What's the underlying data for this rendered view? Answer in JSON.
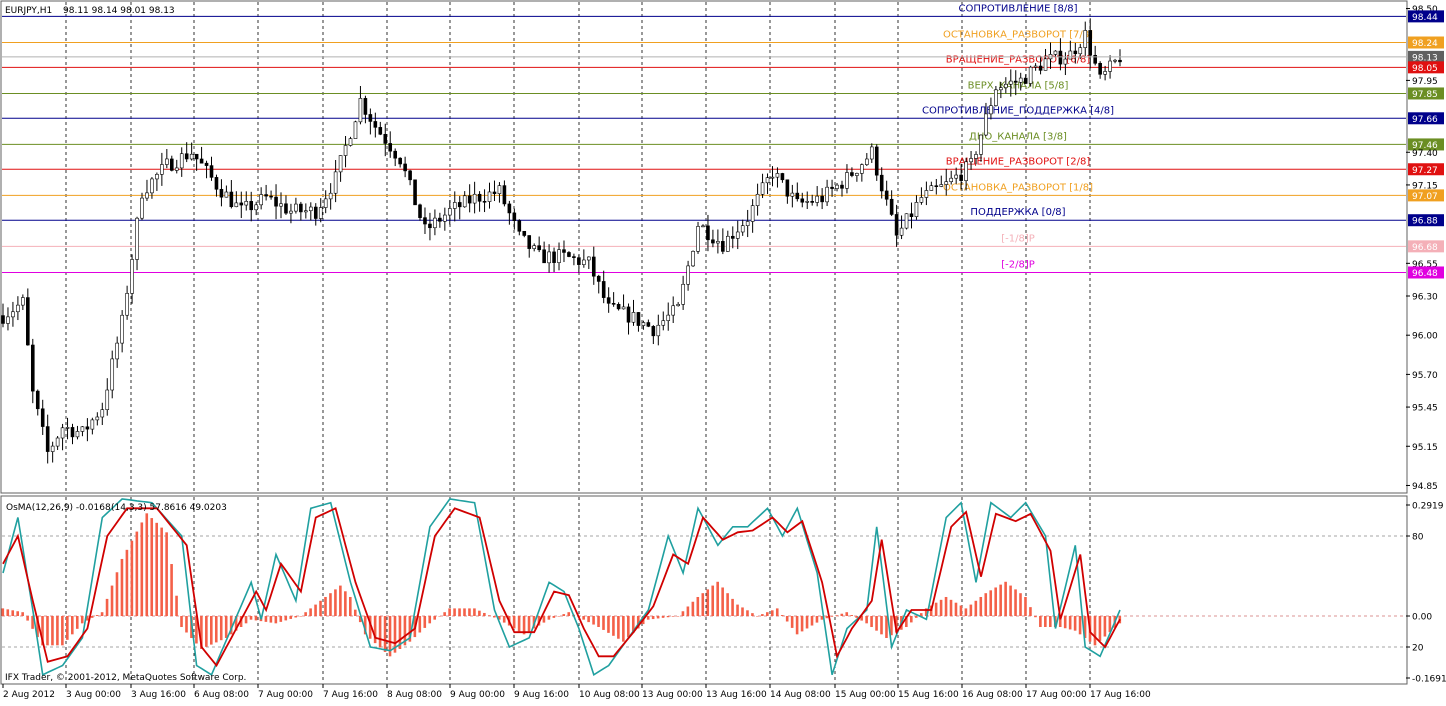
{
  "header": {
    "symbol": "EURJPY,H1",
    "ohlc": "98.11 98.14 98.01 98.13"
  },
  "indicator": {
    "header": "OsMA(12,26,9) -0.0168",
    "header2": "(14,3,3) 57.8616 49.0203"
  },
  "copyright": "IFX Trader, © 2001-2012, MetaQuotes Software Corp.",
  "colors": {
    "blue": "#00008b",
    "orange": "#f0a020",
    "red": "#e01010",
    "olive": "#6b8e23",
    "pink": "#f4b0b8",
    "magenta": "#e000e0",
    "hist": "#f46048",
    "osc_fast": "#20a0a0",
    "osc_slow": "#d00000",
    "candle": "#000000"
  },
  "chart_data": [
    {
      "type": "candlestick",
      "title": "EURJPY,H1",
      "ylim": [
        94.8,
        98.55
      ],
      "y_ticks": [
        "98.50",
        "98.44",
        "98.24",
        "98.13",
        "98.05",
        "97.95",
        "97.85",
        "97.66",
        "97.46",
        "97.40",
        "97.27",
        "97.15",
        "97.07",
        "96.88",
        "96.68",
        "96.55",
        "96.48",
        "96.30",
        "96.00",
        "95.70",
        "95.45",
        "95.15",
        "94.85"
      ],
      "x_ticks": [
        "2 Aug 2012",
        "3 Aug 00:00",
        "3 Aug 16:00",
        "6 Aug 08:00",
        "7 Aug 00:00",
        "7 Aug 16:00",
        "8 Aug 08:00",
        "9 Aug 00:00",
        "9 Aug 16:00",
        "10 Aug 08:00",
        "13 Aug 00:00",
        "13 Aug 16:00",
        "14 Aug 08:00",
        "15 Aug 00:00",
        "15 Aug 16:00",
        "16 Aug 08:00",
        "17 Aug 00:00",
        "17 Aug 16:00"
      ],
      "last_price": 98.13,
      "path_points": [
        [
          0,
          96.15
        ],
        [
          4,
          96.25
        ],
        [
          6,
          95.55
        ],
        [
          9,
          95.1
        ],
        [
          12,
          95.3
        ],
        [
          16,
          95.25
        ],
        [
          20,
          95.45
        ],
        [
          24,
          96.1
        ],
        [
          28,
          97.1
        ],
        [
          33,
          97.3
        ],
        [
          38,
          97.4
        ],
        [
          43,
          97.15
        ],
        [
          48,
          96.95
        ],
        [
          53,
          97.05
        ],
        [
          58,
          96.95
        ],
        [
          63,
          96.95
        ],
        [
          67,
          97.2
        ],
        [
          72,
          97.8
        ],
        [
          75,
          97.6
        ],
        [
          80,
          97.35
        ],
        [
          85,
          96.8
        ],
        [
          90,
          96.95
        ],
        [
          95,
          97.05
        ],
        [
          100,
          97.1
        ],
        [
          104,
          96.75
        ],
        [
          108,
          96.6
        ],
        [
          113,
          96.6
        ],
        [
          118,
          96.55
        ],
        [
          122,
          96.2
        ],
        [
          126,
          96.15
        ],
        [
          131,
          96.05
        ],
        [
          136,
          96.2
        ],
        [
          140,
          96.85
        ],
        [
          145,
          96.7
        ],
        [
          150,
          96.9
        ],
        [
          155,
          97.25
        ],
        [
          160,
          97.0
        ],
        [
          165,
          97.05
        ],
        [
          170,
          97.2
        ],
        [
          175,
          97.4
        ],
        [
          180,
          96.75
        ],
        [
          185,
          97.05
        ],
        [
          190,
          97.15
        ],
        [
          195,
          97.3
        ],
        [
          200,
          97.9
        ],
        [
          205,
          97.95
        ],
        [
          210,
          98.1
        ],
        [
          215,
          98.15
        ],
        [
          218,
          98.3
        ],
        [
          221,
          97.95
        ],
        [
          225,
          98.13
        ]
      ],
      "levels": [
        {
          "label": "СОПРОТИВЛЕНИЕ [8/8]",
          "value": "98.44",
          "color": "blue"
        },
        {
          "label": "ОСТАНОВКА_РАЗВОРОТ [7/8]",
          "value": "98.24",
          "color": "orange"
        },
        {
          "label": "ВРАЩЕНИЕ_РАЗВОРОТ [6/8]",
          "value": "98.05",
          "color": "red"
        },
        {
          "label": "ВЕРХ_КАНАЛА [5/8]",
          "value": "97.85",
          "color": "olive"
        },
        {
          "label": "СОПРОТИВЛЕНИЕ_ПОДДЕРЖКА [4/8]",
          "value": "97.66",
          "color": "blue"
        },
        {
          "label": "ДНО_КАНАЛА [3/8]",
          "value": "97.46",
          "color": "olive"
        },
        {
          "label": "ВРАЩЕНИЕ_РАЗВОРОТ [2/8]",
          "value": "97.27",
          "color": "red"
        },
        {
          "label": "ОСТАНОВКА_РАЗВОРОТ [1/8]",
          "value": "97.07",
          "color": "orange"
        },
        {
          "label": "ПОДДЕРЖКА [0/8]",
          "value": "96.88",
          "color": "blue"
        },
        {
          "label": "[-1/8]P",
          "value": "96.68",
          "color": "pink"
        },
        {
          "label": "[-2/8]P",
          "value": "96.48",
          "color": "magenta"
        }
      ]
    },
    {
      "type": "bar",
      "title": "OsMA(12,26,9) -0.0168",
      "ylim": [
        -0.1691,
        0.2919
      ],
      "y_ticks": [
        "0.2919",
        "80",
        "0.00",
        "20",
        "-0.1691"
      ],
      "histogram_keypoints": [
        [
          0,
          0.02
        ],
        [
          4,
          0.01
        ],
        [
          8,
          -0.08
        ],
        [
          12,
          -0.08
        ],
        [
          16,
          -0.02
        ],
        [
          20,
          0.01
        ],
        [
          24,
          0.15
        ],
        [
          29,
          0.27
        ],
        [
          33,
          0.22
        ],
        [
          36,
          -0.03
        ],
        [
          40,
          -0.09
        ],
        [
          45,
          -0.06
        ],
        [
          50,
          -0.01
        ],
        [
          55,
          -0.02
        ],
        [
          60,
          0.0
        ],
        [
          64,
          0.04
        ],
        [
          68,
          0.08
        ],
        [
          70,
          0.05
        ],
        [
          73,
          -0.05
        ],
        [
          78,
          -0.11
        ],
        [
          82,
          -0.07
        ],
        [
          86,
          -0.02
        ],
        [
          90,
          0.02
        ],
        [
          95,
          0.02
        ],
        [
          100,
          -0.01
        ],
        [
          105,
          -0.05
        ],
        [
          110,
          -0.01
        ],
        [
          114,
          0.01
        ],
        [
          120,
          -0.03
        ],
        [
          125,
          -0.07
        ],
        [
          130,
          -0.01
        ],
        [
          136,
          0.0
        ],
        [
          140,
          0.05
        ],
        [
          144,
          0.09
        ],
        [
          148,
          0.03
        ],
        [
          152,
          0.0
        ],
        [
          156,
          0.02
        ],
        [
          160,
          -0.05
        ],
        [
          165,
          -0.01
        ],
        [
          170,
          0.01
        ],
        [
          174,
          -0.02
        ],
        [
          178,
          -0.06
        ],
        [
          182,
          -0.03
        ],
        [
          186,
          0.02
        ],
        [
          190,
          0.05
        ],
        [
          194,
          0.02
        ],
        [
          198,
          0.06
        ],
        [
          202,
          0.09
        ],
        [
          206,
          0.05
        ],
        [
          209,
          -0.03
        ],
        [
          213,
          -0.03
        ],
        [
          216,
          -0.04
        ],
        [
          220,
          -0.08
        ],
        [
          225,
          -0.02
        ]
      ],
      "stochastic": {
        "fast_keypoints": [
          [
            0,
            60
          ],
          [
            3,
            90
          ],
          [
            6,
            40
          ],
          [
            8,
            5
          ],
          [
            12,
            10
          ],
          [
            16,
            25
          ],
          [
            20,
            90
          ],
          [
            24,
            100
          ],
          [
            30,
            98
          ],
          [
            36,
            80
          ],
          [
            39,
            10
          ],
          [
            42,
            5
          ],
          [
            46,
            30
          ],
          [
            50,
            55
          ],
          [
            52,
            35
          ],
          [
            55,
            70
          ],
          [
            59,
            45
          ],
          [
            62,
            95
          ],
          [
            66,
            98
          ],
          [
            70,
            55
          ],
          [
            74,
            20
          ],
          [
            78,
            18
          ],
          [
            82,
            25
          ],
          [
            86,
            85
          ],
          [
            90,
            100
          ],
          [
            95,
            98
          ],
          [
            99,
            40
          ],
          [
            102,
            20
          ],
          [
            106,
            25
          ],
          [
            110,
            55
          ],
          [
            113,
            50
          ],
          [
            116,
            30
          ],
          [
            119,
            5
          ],
          [
            122,
            10
          ],
          [
            126,
            25
          ],
          [
            130,
            40
          ],
          [
            134,
            80
          ],
          [
            137,
            60
          ],
          [
            140,
            95
          ],
          [
            144,
            75
          ],
          [
            147,
            85
          ],
          [
            150,
            85
          ],
          [
            154,
            95
          ],
          [
            157,
            80
          ],
          [
            160,
            95
          ],
          [
            164,
            60
          ],
          [
            167,
            5
          ],
          [
            170,
            30
          ],
          [
            174,
            40
          ],
          [
            176,
            85
          ],
          [
            179,
            20
          ],
          [
            182,
            40
          ],
          [
            186,
            35
          ],
          [
            190,
            90
          ],
          [
            193,
            98
          ],
          [
            196,
            55
          ],
          [
            199,
            98
          ],
          [
            203,
            90
          ],
          [
            206,
            98
          ],
          [
            210,
            80
          ],
          [
            212,
            30
          ],
          [
            216,
            75
          ],
          [
            218,
            20
          ],
          [
            221,
            15
          ],
          [
            225,
            40
          ]
        ],
        "slow_keypoints": [
          [
            0,
            65
          ],
          [
            3,
            80
          ],
          [
            6,
            45
          ],
          [
            9,
            12
          ],
          [
            13,
            15
          ],
          [
            17,
            30
          ],
          [
            21,
            80
          ],
          [
            25,
            95
          ],
          [
            31,
            95
          ],
          [
            37,
            75
          ],
          [
            40,
            20
          ],
          [
            43,
            10
          ],
          [
            47,
            30
          ],
          [
            51,
            50
          ],
          [
            53,
            40
          ],
          [
            56,
            65
          ],
          [
            60,
            50
          ],
          [
            63,
            90
          ],
          [
            67,
            95
          ],
          [
            71,
            55
          ],
          [
            75,
            25
          ],
          [
            79,
            22
          ],
          [
            83,
            30
          ],
          [
            87,
            80
          ],
          [
            91,
            95
          ],
          [
            96,
            90
          ],
          [
            100,
            45
          ],
          [
            103,
            28
          ],
          [
            107,
            28
          ],
          [
            111,
            50
          ],
          [
            114,
            48
          ],
          [
            117,
            30
          ],
          [
            120,
            15
          ],
          [
            123,
            15
          ],
          [
            127,
            28
          ],
          [
            131,
            42
          ],
          [
            135,
            70
          ],
          [
            138,
            65
          ],
          [
            141,
            90
          ],
          [
            145,
            78
          ],
          [
            148,
            82
          ],
          [
            151,
            83
          ],
          [
            155,
            90
          ],
          [
            158,
            82
          ],
          [
            161,
            88
          ],
          [
            165,
            55
          ],
          [
            168,
            15
          ],
          [
            171,
            30
          ],
          [
            175,
            45
          ],
          [
            177,
            78
          ],
          [
            180,
            28
          ],
          [
            183,
            40
          ],
          [
            187,
            40
          ],
          [
            191,
            85
          ],
          [
            194,
            93
          ],
          [
            197,
            58
          ],
          [
            200,
            92
          ],
          [
            204,
            88
          ],
          [
            207,
            92
          ],
          [
            211,
            72
          ],
          [
            213,
            35
          ],
          [
            217,
            70
          ],
          [
            219,
            28
          ],
          [
            222,
            20
          ],
          [
            225,
            35
          ]
        ]
      }
    }
  ]
}
